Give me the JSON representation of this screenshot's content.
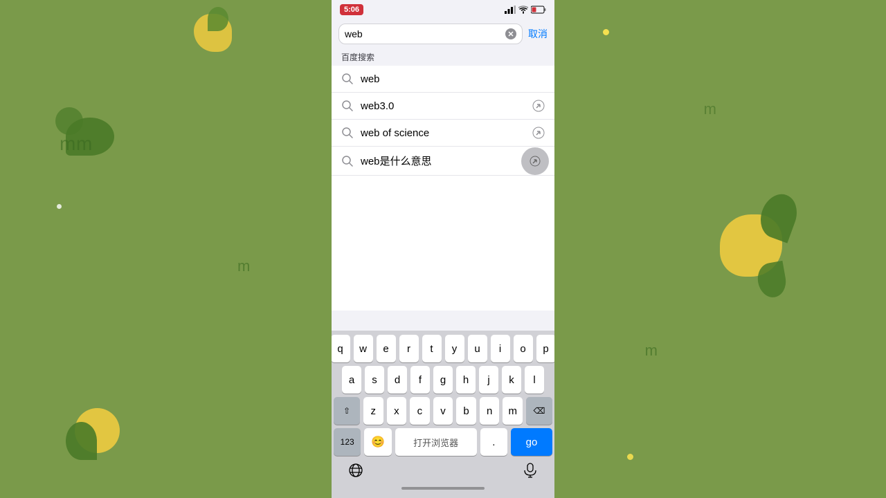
{
  "background": {
    "color": "#7a9a4a"
  },
  "status_bar": {
    "time": "5:06",
    "signal": "▋▋▋",
    "wifi": "WiFi",
    "battery": "🔋"
  },
  "search_bar": {
    "input_value": "web",
    "cancel_label": "取消"
  },
  "suggestions_section": {
    "header": "百度搜索",
    "items": [
      {
        "text": "web",
        "has_arrow": false
      },
      {
        "text": "web3.0",
        "has_arrow": true
      },
      {
        "text": "web of science",
        "has_arrow": true
      },
      {
        "text": "web是什么意思",
        "has_arrow": true
      }
    ]
  },
  "keyboard": {
    "row1": [
      "q",
      "w",
      "e",
      "r",
      "t",
      "y",
      "u",
      "i",
      "o",
      "p"
    ],
    "row2": [
      "a",
      "s",
      "d",
      "f",
      "g",
      "h",
      "j",
      "k",
      "l"
    ],
    "row3": [
      "z",
      "x",
      "c",
      "v",
      "b",
      "n",
      "m"
    ],
    "shift_label": "⇧",
    "delete_label": "⌫",
    "num_label": "123",
    "emoji_label": "😊",
    "space_label": "打开浏览器",
    "dot_label": ".",
    "go_label": "go"
  }
}
